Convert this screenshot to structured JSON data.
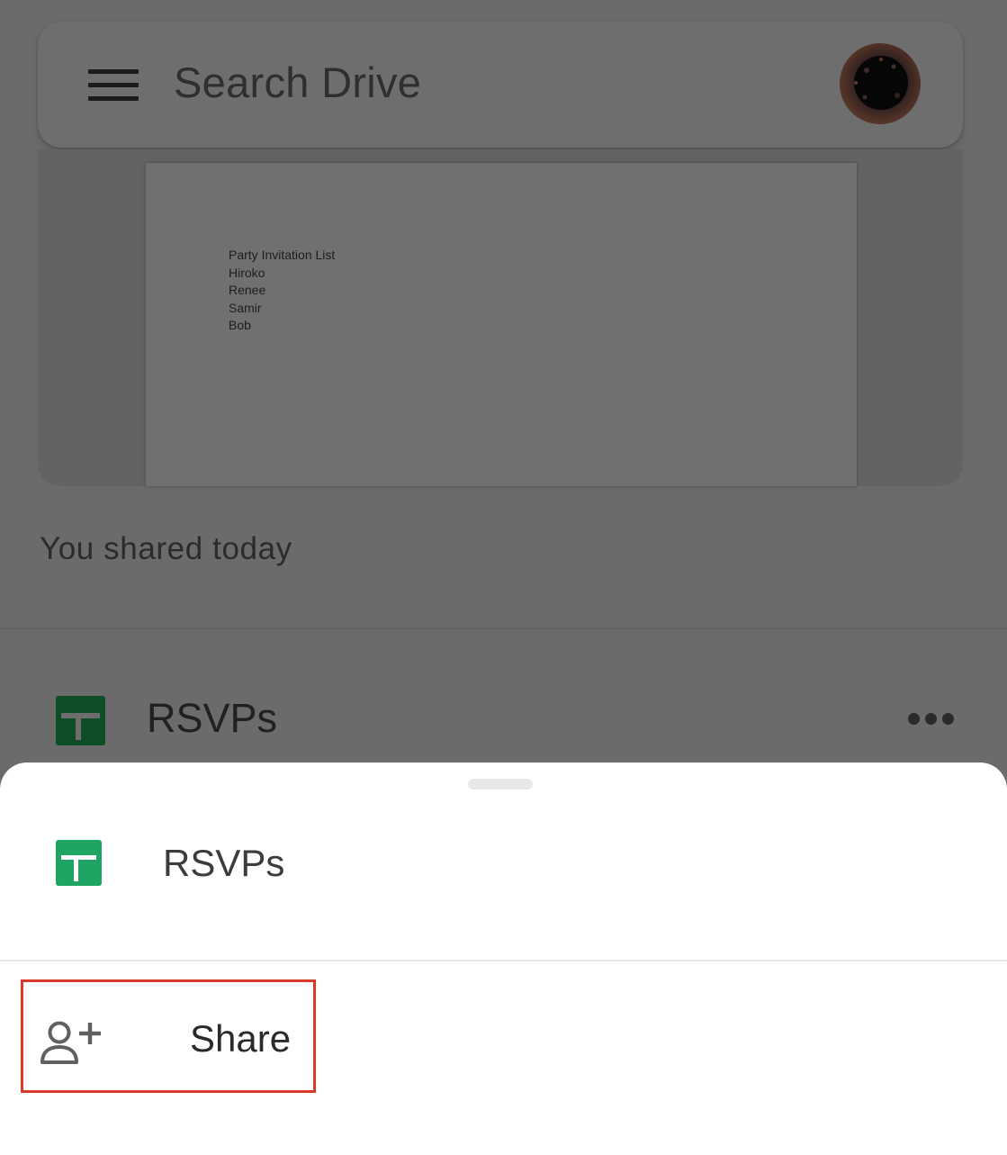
{
  "search_bar": {
    "placeholder": "Search Drive"
  },
  "icons": {
    "menu": "hamburger-menu-icon",
    "avatar": "user-avatar",
    "file_type": "google-sheets-icon",
    "more": "more-horizontal-icon",
    "share": "person-add-icon"
  },
  "preview": {
    "lines": [
      "Party Invitation List",
      "Hiroko",
      "Renee",
      "Samir",
      "Bob"
    ]
  },
  "activity": {
    "label": "You shared today"
  },
  "file": {
    "name": "RSVPs"
  },
  "bottom_sheet": {
    "title": "RSVPs",
    "actions": [
      {
        "label": "Share",
        "icon": "person-add-icon",
        "highlighted": true
      }
    ]
  },
  "colors": {
    "sheets_green": "#1fa463",
    "highlight_red": "#d93a2b",
    "scrim": "#6b6b6b"
  }
}
